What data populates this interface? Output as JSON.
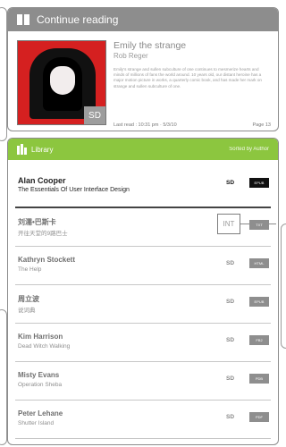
{
  "continue_reading": {
    "header": "Continue reading",
    "book": {
      "title": "Emily the strange",
      "author": "Rob Reger",
      "cover_badge": "SD",
      "description": "Emily's strange and sullen subculture of one continues to mesmerize hearts and minds of millions of fans the world around. 10 years old, our distant heroine has a major motion picture in works, a quarterly comic book, and has made her mark on strange and sullen subculture of one."
    },
    "last_read": "Last read : 10:31 pm · 5/3/10",
    "page": "Page 13"
  },
  "library": {
    "header": "Library",
    "sorted_by": "Sorted by Author",
    "items": [
      {
        "author": "Alan Cooper",
        "title": "The Essentials Of User Interface Design",
        "storage": "SD",
        "format": "EPUB"
      },
      {
        "author": "刘濡•巴斯卡",
        "title": "开往天堂的9路巴士",
        "storage": "INT",
        "format": "TXT"
      },
      {
        "author": "Kathryn Stockett",
        "title": "The Help",
        "storage": "SD",
        "format": "HTML"
      },
      {
        "author": "周立波",
        "title": "说词典",
        "storage": "SD",
        "format": "EPUB"
      },
      {
        "author": "Kim Harrison",
        "title": "Dead Witch Walking",
        "storage": "SD",
        "format": "FB2"
      },
      {
        "author": "Misty Evans",
        "title": "Operation Sheba",
        "storage": "SD",
        "format": "PDB"
      },
      {
        "author": "Peter Lehane",
        "title": "Shutter Island",
        "storage": "SD",
        "format": "PDF"
      }
    ]
  },
  "colors": {
    "continue_header": "#8d8d8d",
    "library_header": "#8cc63f",
    "selected_badge": "#111111",
    "format_badge": "#8e8e8e"
  },
  "icons": {
    "continue_icon": "book-icon",
    "library_icon": "library-icon"
  }
}
